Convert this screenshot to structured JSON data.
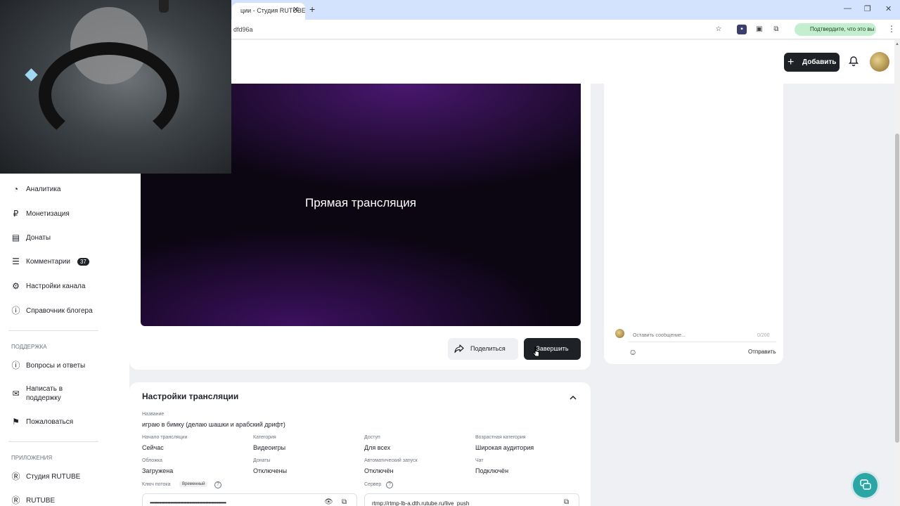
{
  "browser": {
    "tab_title": "ции - Студия RUTUBE",
    "tab_close": "✕",
    "new_tab": "+",
    "url": "dfd96a",
    "extension_pill": "Подтвердите, что это вы",
    "minimize": "—",
    "maximize": "❐",
    "close": "✕"
  },
  "header": {
    "add_label": "Добавить"
  },
  "sidebar": {
    "items": [
      {
        "label": "Аналитика"
      },
      {
        "label": "Монетизация"
      },
      {
        "label": "Донаты"
      },
      {
        "label": "Комментарии",
        "badge": "37"
      },
      {
        "label": "Настройки канала"
      },
      {
        "label": "Справочник блогера"
      }
    ],
    "support_heading": "ПОДДЕРЖКА",
    "support_items": [
      {
        "label": "Вопросы и ответы"
      },
      {
        "label": "Написать в поддержку"
      },
      {
        "label": "Пожаловаться"
      }
    ],
    "apps_heading": "ПРИЛОЖЕНИЯ",
    "apps_items": [
      {
        "label": "Студия RUTUBE"
      },
      {
        "label": "RUTUBE"
      }
    ]
  },
  "video": {
    "overlay_text": "Прямая трансляция",
    "share_label": "Поделиться",
    "finish_label": "Завершить"
  },
  "chat": {
    "placeholder": "Оставить сообщение...",
    "counter": "0/200",
    "send_label": "Отправить"
  },
  "settings": {
    "title": "Настройки трансляции",
    "name_label": "Название",
    "name_value": "играю в бимку (делаю шашки и арабский дрифт)",
    "fields": [
      {
        "label": "Начало трансляции",
        "value": "Сейчас"
      },
      {
        "label": "Категория",
        "value": "Видеоигры"
      },
      {
        "label": "Доступ",
        "value": "Для всех"
      },
      {
        "label": "Возрастная категория",
        "value": "Широкая аудитория"
      },
      {
        "label": "Обложка",
        "value": "Загружена"
      },
      {
        "label": "Донаты",
        "value": "Отключены"
      },
      {
        "label": "Автоматический запуск",
        "value": "Отключён"
      },
      {
        "label": "Чат",
        "value": "Подключён"
      }
    ],
    "stream_key_label": "Ключ потока",
    "stream_key_badge": "Временный",
    "stream_key_value": "••••••••••••••••••••••••••••••••••••••••••••••••••••••••••••",
    "server_label": "Сервер",
    "server_value": "rtmp://rtmp-lb-a.dth.rutube.ru/live_push"
  },
  "colors": {
    "accent_dark": "#1e2226",
    "fab": "#2aa7a4",
    "video_purple": "#4a1770"
  }
}
